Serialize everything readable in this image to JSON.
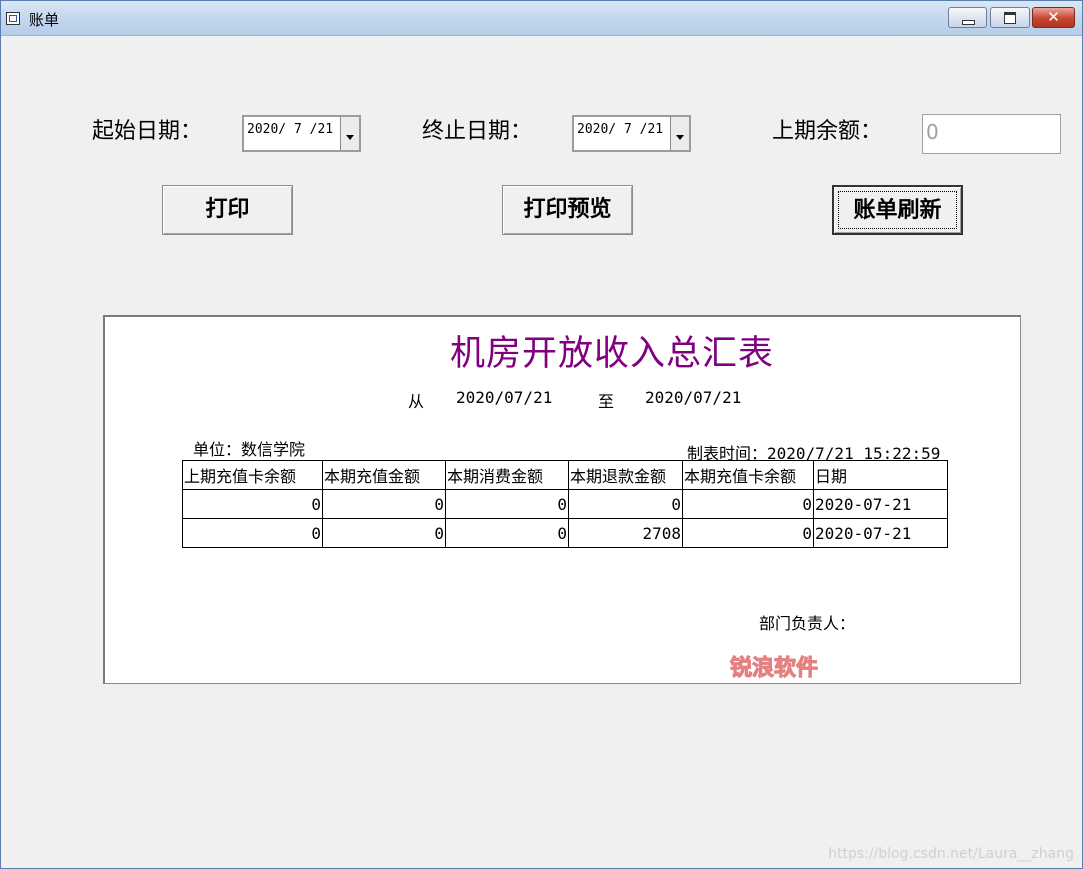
{
  "window": {
    "title": "账单"
  },
  "controls": {
    "start_label": "起始日期：",
    "start_value": "2020/ 7 /21",
    "end_label": "终止日期：",
    "end_value": "2020/ 7 /21",
    "balance_label": "上期余额：",
    "balance_value": "0"
  },
  "buttons": {
    "print": "打印",
    "preview": "打印预览",
    "refresh": "账单刷新"
  },
  "report": {
    "title": "机房开放收入总汇表",
    "from_label": "从",
    "from_date": "2020/07/21",
    "to_label": "至",
    "to_date": "2020/07/21",
    "unit": "单位：数信学院",
    "made_time": "制表时间：2020/7/21 15:22:59",
    "columns": [
      "上期充值卡余额",
      "本期充值金额",
      "本期消费金额",
      "本期退款金额",
      "本期充值卡余额",
      "日期"
    ],
    "rows": [
      [
        "0",
        "0",
        "0",
        "0",
        "0",
        "2020-07-21"
      ],
      [
        "0",
        "0",
        "0",
        "2708",
        "0",
        "2020-07-21"
      ]
    ],
    "responsible": "部门负责人：",
    "watermark": "锐浪软件 GRID++REPORT"
  },
  "footer_watermark": "https://blog.csdn.net/Laura__zhang"
}
